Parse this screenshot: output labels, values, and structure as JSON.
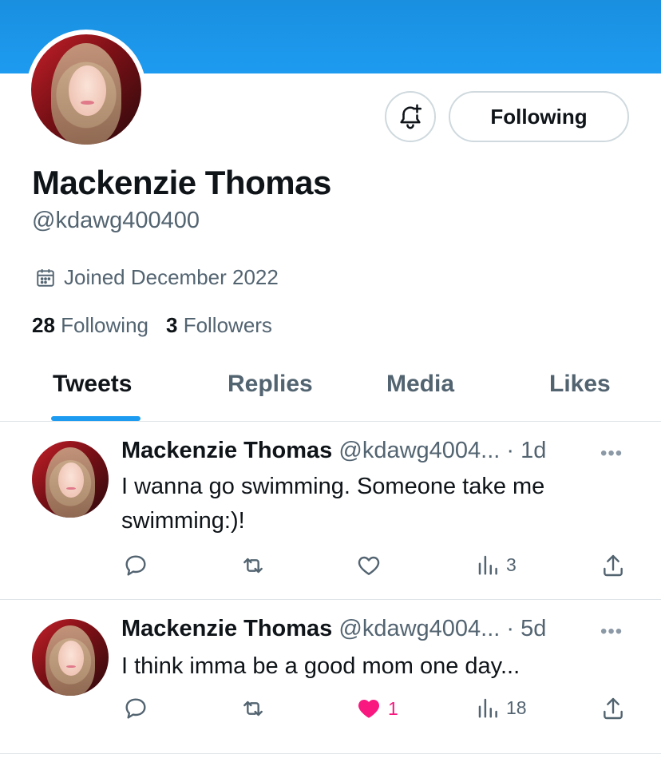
{
  "profile": {
    "name": "Mackenzie Thomas",
    "handle": "@kdawg400400",
    "joined": "Joined December 2022",
    "following_count": "28",
    "following_label": "Following",
    "followers_count": "3",
    "followers_label": "Followers",
    "follow_button_label": "Following"
  },
  "colors": {
    "banner": "#1d9bf0",
    "accent": "#1d9bf0",
    "like": "#f91880",
    "muted": "#536471"
  },
  "tabs": [
    {
      "label": "Tweets",
      "active": true
    },
    {
      "label": "Replies",
      "active": false
    },
    {
      "label": "Media",
      "active": false
    },
    {
      "label": "Likes",
      "active": false
    }
  ],
  "tweets": [
    {
      "name": "Mackenzie Thomas",
      "handle_time": "@kdawg4004... · 1d",
      "text": "I wanna go swimming. Someone take me swimming:)!",
      "likes": "",
      "views": "3",
      "liked": false
    },
    {
      "name": "Mackenzie Thomas",
      "handle_time": "@kdawg4004... · 5d",
      "text": "I think imma be a good mom one day...",
      "likes": "1",
      "views": "18",
      "liked": true
    }
  ],
  "icons": {
    "bell": "bell-plus-icon",
    "calendar": "calendar-icon",
    "reply": "reply-icon",
    "retweet": "retweet-icon",
    "like": "heart-icon",
    "views": "views-icon",
    "share": "share-icon",
    "more": "more-icon"
  }
}
